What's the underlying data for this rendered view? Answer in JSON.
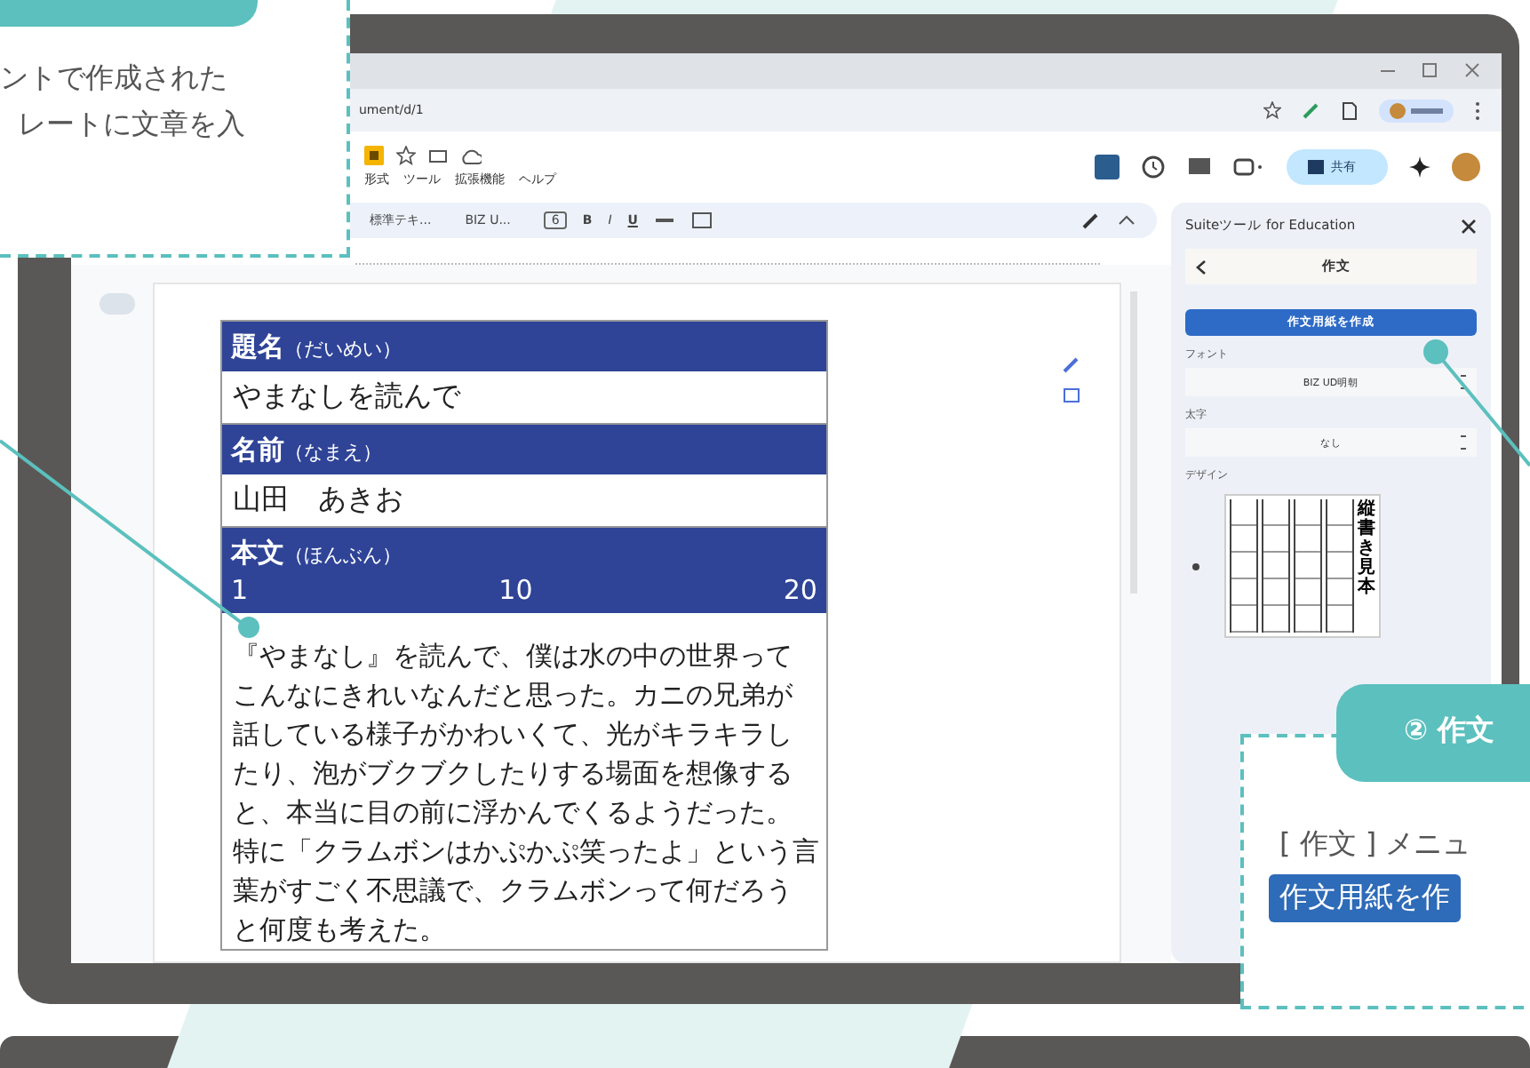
{
  "callout_top": {
    "lines": [
      "ントで作成された",
      "レートに文章を入"
    ]
  },
  "browser": {
    "url": "ument/d/1"
  },
  "docs": {
    "menu": [
      "形式",
      "ツール",
      "拡張機能",
      "ヘルプ"
    ],
    "share": "共有",
    "toolbar": {
      "style": "標準テキ...",
      "font": "BIZ U...",
      "size": "6",
      "formats": [
        "B",
        "I",
        "U"
      ]
    }
  },
  "document": {
    "sections": [
      {
        "heading": "題名",
        "reading": "（だいめい）",
        "value": "やまなしを読んで"
      },
      {
        "heading": "名前",
        "reading": "（なまえ）",
        "value": "山田　あきお"
      },
      {
        "heading": "本文",
        "reading": "（ほんぶん）",
        "scale": [
          "1",
          "10",
          "20"
        ],
        "body_lines": [
          "『やまなし』を読んで、僕は水の中の世界って",
          "こんなにきれいなんだと思った。カニの兄弟が",
          "話している様子がかわいくて、光がキラキラし",
          "たり、泡がブクブクしたりする場面を想像する",
          "と、本当に目の前に浮かんでくるようだった。",
          "特に「クラムボンはかぷかぷ笑ったよ」という言",
          "葉がすごく不思議で、クラムボンって何だろう",
          "と何度も考えた。"
        ]
      }
    ]
  },
  "side_panel": {
    "title": "Suiteツール for Education",
    "page_title": "作文",
    "action": "作文用紙を作成",
    "fields": [
      {
        "label": "フォント",
        "value": "BIZ UD明朝"
      },
      {
        "label": "太字",
        "value": "なし"
      }
    ],
    "design_label": "デザイン",
    "design_sample": "縦書き見本"
  },
  "callout_bottom": {
    "tab": "② 作文",
    "text": "[ 作文 ] メニュ",
    "highlight": "作文用紙を作"
  }
}
